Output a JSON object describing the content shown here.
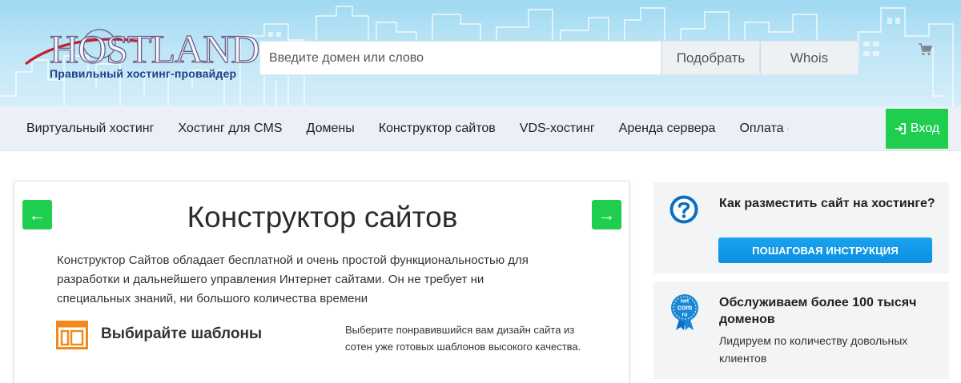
{
  "brand": {
    "logo_text": "HOSTLAND",
    "tagline": "Правильный хостинг-провайдер"
  },
  "search": {
    "placeholder": "Введите домен или слово",
    "pick_button": "Подобрать",
    "whois_button": "Whois"
  },
  "nav": {
    "items": [
      {
        "label": "Виртуальный хостинг"
      },
      {
        "label": "Хостинг для CMS"
      },
      {
        "label": "Домены"
      },
      {
        "label": "Конструктор сайтов"
      },
      {
        "label": "VDS-хостинг"
      },
      {
        "label": "Аренда сервера"
      },
      {
        "label": "Оплата"
      }
    ],
    "more_arrow": "›",
    "login": "Вход"
  },
  "main": {
    "prev_arrow": "←",
    "next_arrow": "→",
    "title": "Конструктор сайтов",
    "description": "Конструктор Сайтов обладает бесплатной и очень простой функциональностью для разработки и дальнейшего управления Интернет сайтами. Он не требует ни специальных знаний, ни большого количества времени",
    "feature": {
      "title": "Выбирайте шаблоны",
      "description": "Выберите понравившийся вам дизайн сайта из сотен уже готовых шаблонов высокого качества."
    }
  },
  "sidebar": {
    "howto": {
      "title": "Как разместить сайт на хостинге?",
      "button": "ПОШАГОВАЯ ИНСТРУКЦИЯ"
    },
    "stats": {
      "badge_lines": [
        "net",
        "com",
        "ru"
      ],
      "title": "Обслуживаем более 100 тысяч доменов",
      "text": "Лидируем по количеству довольных клиентов"
    }
  },
  "colors": {
    "header_sky": "#bde5f6",
    "nav_bg": "#eaf0f6",
    "green": "#1fce4f",
    "blue_button": "#0c8fe0",
    "sidebar_bg": "#f2f4f6",
    "feature_orange": "#f08a1c"
  },
  "icons": [
    "cart-icon",
    "login-icon",
    "arrow-left-icon",
    "arrow-right-icon",
    "template-icon",
    "question-icon",
    "domain-badge-icon"
  ]
}
